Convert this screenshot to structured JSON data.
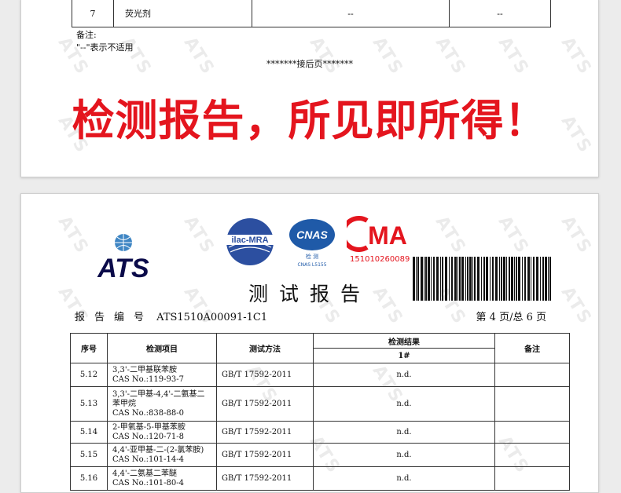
{
  "top_report": {
    "row": {
      "num": "7",
      "item": "荧光剂",
      "result": "--",
      "note": "--"
    },
    "notes_label": "备注:",
    "notes_text": "\"--\"表示不适用",
    "continue_text": "*******接后页*******",
    "banner": "检测报告，所见即所得！"
  },
  "watermark": "ATS",
  "header": {
    "company_logo_text": "ATS",
    "ilac_text": "ilac-MRA",
    "cnas_text": "CNAS",
    "cnas_sub1": "检 测",
    "cnas_sub2": "CNAS L5155",
    "cma_text": "MA",
    "cma_number": "151010260089",
    "title": "测试报告",
    "report_no_label": "报告编号",
    "report_no": "ATS1510A00091-1C1",
    "page_info": "第 4 页/总 6 页"
  },
  "table": {
    "headers": {
      "num": "序号",
      "item": "检测项目",
      "method": "测试方法",
      "result": "检测结果",
      "sample": "1#",
      "note": "备注"
    },
    "rows": [
      {
        "num": "5.12",
        "item": [
          "3,3'-二甲基联苯胺",
          "CAS No.:119-93-7"
        ],
        "method": "GB/T 17592-2011",
        "result": "n.d."
      },
      {
        "num": "5.13",
        "item": [
          "3,3'-二甲基-4,4'-二氨基二",
          "苯甲烷",
          "CAS No.:838-88-0"
        ],
        "method": "GB/T 17592-2011",
        "result": "n.d."
      },
      {
        "num": "5.14",
        "item": [
          "2-甲氧基-5-甲基苯胺",
          "CAS No.:120-71-8"
        ],
        "method": "GB/T 17592-2011",
        "result": "n.d."
      },
      {
        "num": "5.15",
        "item": [
          "4,4'-亚甲基-二-(2-氯苯胺)",
          "CAS No.:101-14-4"
        ],
        "method": "GB/T 17592-2011",
        "result": "n.d."
      },
      {
        "num": "5.16",
        "item": [
          "4,4'-二氨基二苯醚",
          "CAS No.:101-80-4"
        ],
        "method": "GB/T 17592-2011",
        "result": "n.d."
      }
    ]
  }
}
